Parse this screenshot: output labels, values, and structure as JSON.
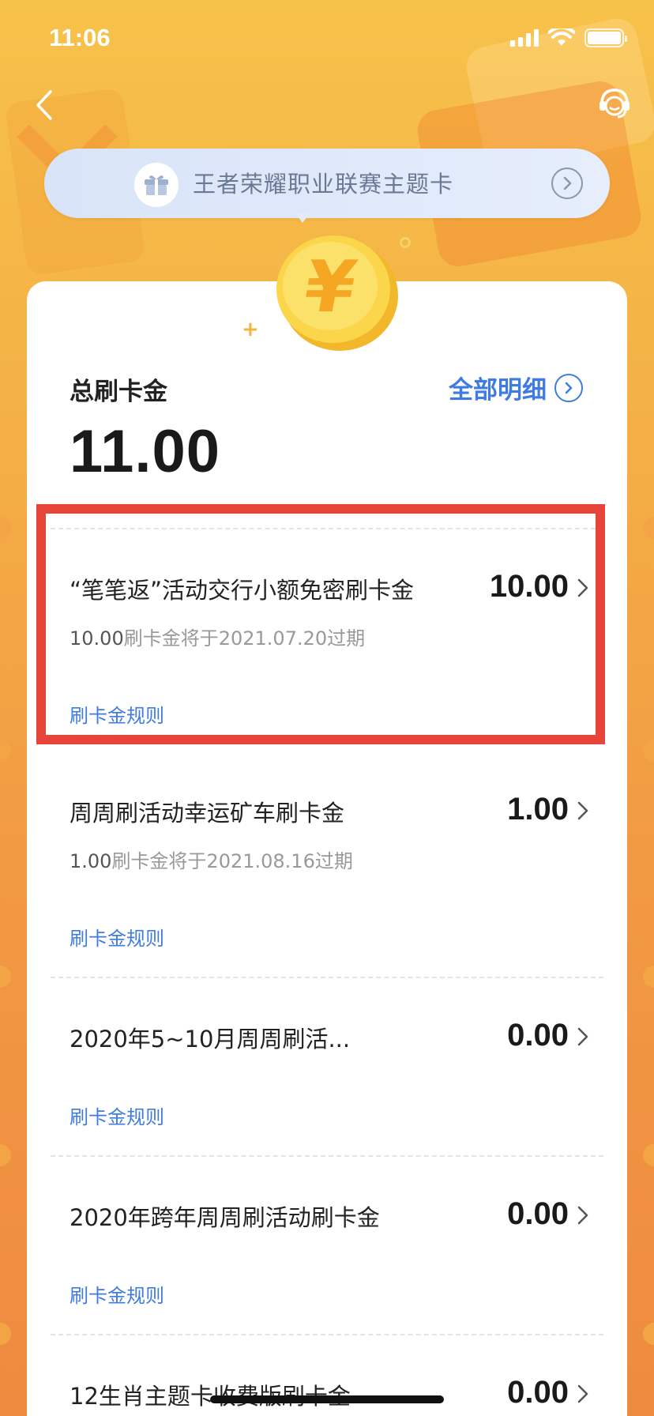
{
  "status": {
    "time": "11:06"
  },
  "banner": {
    "text": "王者荣耀职业联赛主题卡"
  },
  "summary": {
    "label": "总刷卡金",
    "value": "11.00",
    "detail_link": "全部明细"
  },
  "items": [
    {
      "title": "“笔笔返”活动交行小额免密刷卡金",
      "amount": "10.00",
      "sub_amount": "10.00",
      "sub_text": "刷卡金将于2021.07.20过期",
      "rule": "刷卡金规则"
    },
    {
      "title": "周周刷活动幸运矿车刷卡金",
      "amount": "1.00",
      "sub_amount": "1.00",
      "sub_text": "刷卡金将于2021.08.16过期",
      "rule": "刷卡金规则"
    },
    {
      "title": "2020年5~10月周周刷活...",
      "amount": "0.00",
      "rule": "刷卡金规则"
    },
    {
      "title": "2020年跨年周周刷活动刷卡金",
      "amount": "0.00",
      "rule": "刷卡金规则"
    },
    {
      "title": "12生肖主题卡收费版刷卡金",
      "amount": "0.00"
    }
  ],
  "colors": {
    "accent_blue": "#3f7be0",
    "highlight_red": "#e8453a",
    "background_orange": "#f4b045"
  }
}
